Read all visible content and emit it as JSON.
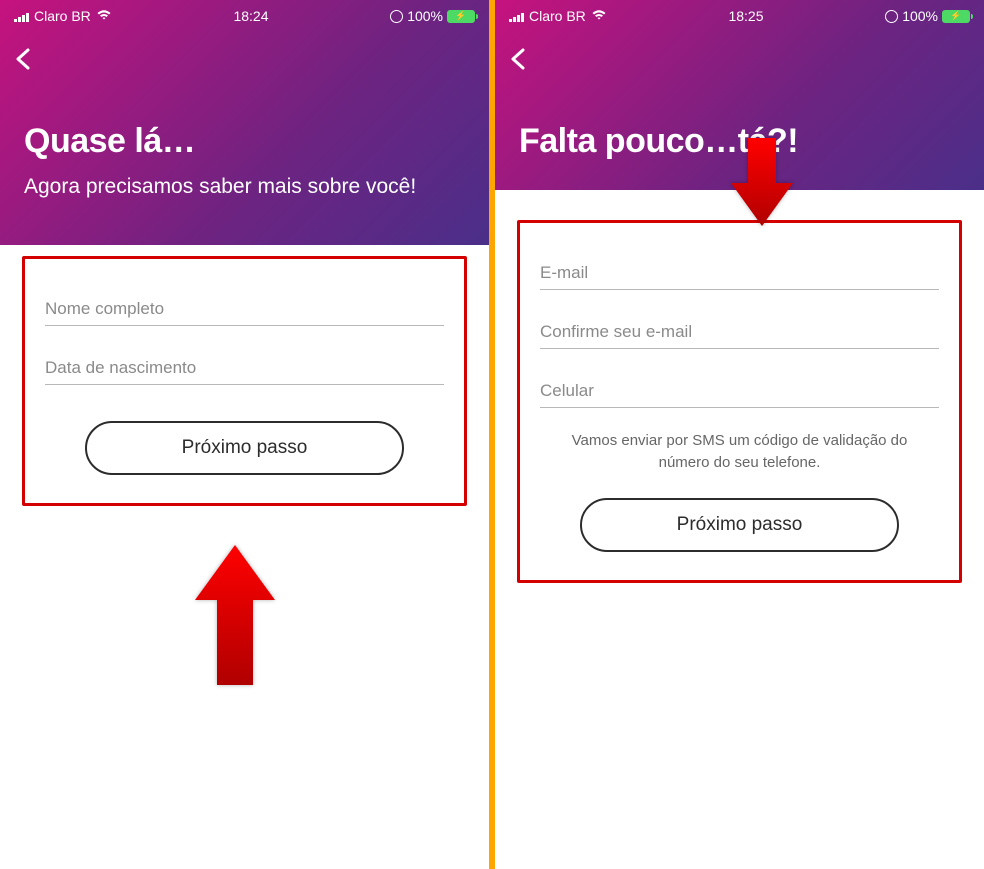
{
  "left": {
    "statusbar": {
      "carrier": "Claro BR",
      "time": "18:24",
      "battery": "100%"
    },
    "header": {
      "title": "Quase lá…",
      "subtitle": "Agora precisamos saber mais sobre você!"
    },
    "form": {
      "name_placeholder": "Nome completo",
      "dob_placeholder": "Data de nascimento",
      "button_label": "Próximo passo"
    }
  },
  "right": {
    "statusbar": {
      "carrier": "Claro BR",
      "time": "18:25",
      "battery": "100%"
    },
    "header": {
      "title": "Falta pouco…tá?!"
    },
    "form": {
      "email_placeholder": "E-mail",
      "confirm_email_placeholder": "Confirme seu e-mail",
      "cellphone_placeholder": "Celular",
      "help_text": "Vamos enviar por SMS um código de validação do número do seu telefone.",
      "button_label": "Próximo passo"
    }
  }
}
